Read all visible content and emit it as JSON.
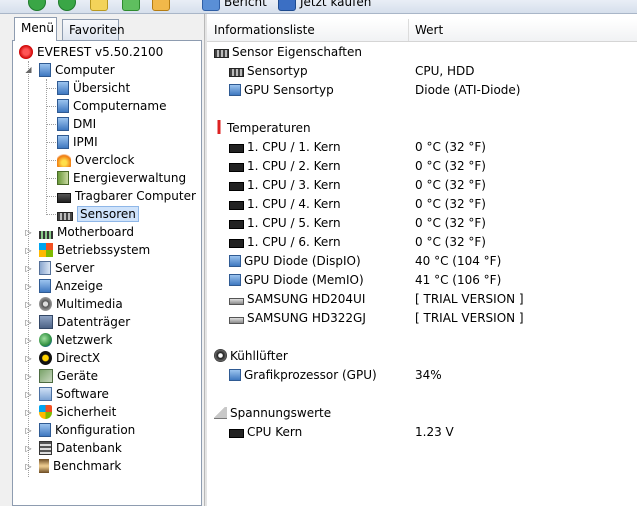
{
  "toolbar": {
    "bericht_label": "Bericht",
    "jetzt_kaufen_label": "Jetzt kaufen"
  },
  "tabs": {
    "menu": "Menü",
    "favorites": "Favoriten"
  },
  "tree": {
    "root": "EVEREST v5.50.2100",
    "computer": "Computer",
    "computer_children": {
      "uebersicht": "Übersicht",
      "computername": "Computername",
      "dmi": "DMI",
      "ipmi": "IPMI",
      "overclock": "Overclock",
      "energie": "Energieverwaltung",
      "tragbar": "Tragbarer Computer",
      "sensoren": "Sensoren"
    },
    "categories": {
      "motherboard": "Motherboard",
      "betriebssystem": "Betriebssystem",
      "server": "Server",
      "anzeige": "Anzeige",
      "multimedia": "Multimedia",
      "datentraeger": "Datenträger",
      "netzwerk": "Netzwerk",
      "directx": "DirectX",
      "geraete": "Geräte",
      "software": "Software",
      "sicherheit": "Sicherheit",
      "konfiguration": "Konfiguration",
      "datenbank": "Datenbank",
      "benchmark": "Benchmark"
    }
  },
  "columns": {
    "info": "Informationsliste",
    "value": "Wert"
  },
  "sections": {
    "sensor": {
      "title": "Sensor Eigenschaften",
      "sensortyp_label": "Sensortyp",
      "sensortyp_value": "CPU, HDD",
      "gpu_sensortyp_label": "GPU Sensortyp",
      "gpu_sensortyp_value": "Diode  (ATI-Diode)"
    },
    "temperaturen": {
      "title": "Temperaturen",
      "cpu1_label": "1. CPU / 1. Kern",
      "cpu1_value": "0 °C  (32 °F)",
      "cpu2_label": "1. CPU / 2. Kern",
      "cpu2_value": "0 °C  (32 °F)",
      "cpu3_label": "1. CPU / 3. Kern",
      "cpu3_value": "0 °C  (32 °F)",
      "cpu4_label": "1. CPU / 4. Kern",
      "cpu4_value": "0 °C  (32 °F)",
      "cpu5_label": "1. CPU / 5. Kern",
      "cpu5_value": "0 °C  (32 °F)",
      "cpu6_label": "1. CPU / 6. Kern",
      "cpu6_value": "0 °C  (32 °F)",
      "gpu_dispio_label": "GPU Diode (DispIO)",
      "gpu_dispio_value": "40 °C  (104 °F)",
      "gpu_memio_label": "GPU Diode (MemIO)",
      "gpu_memio_value": "41 °C  (106 °F)",
      "hdd1_label": "SAMSUNG HD204UI",
      "hdd1_value": "[ TRIAL VERSION ]",
      "hdd2_label": "SAMSUNG HD322GJ",
      "hdd2_value": "[ TRIAL VERSION ]"
    },
    "kuehlluefter": {
      "title": "Kühllüfter",
      "gpu_label": "Grafikprozessor (GPU)",
      "gpu_value": "34%"
    },
    "spannung": {
      "title": "Spannungswerte",
      "cpu_kern_label": "CPU Kern",
      "cpu_kern_value": "1.23 V"
    }
  },
  "colors": {
    "selection": "#cfe3fb",
    "tree_border": "#8e9cb0"
  }
}
